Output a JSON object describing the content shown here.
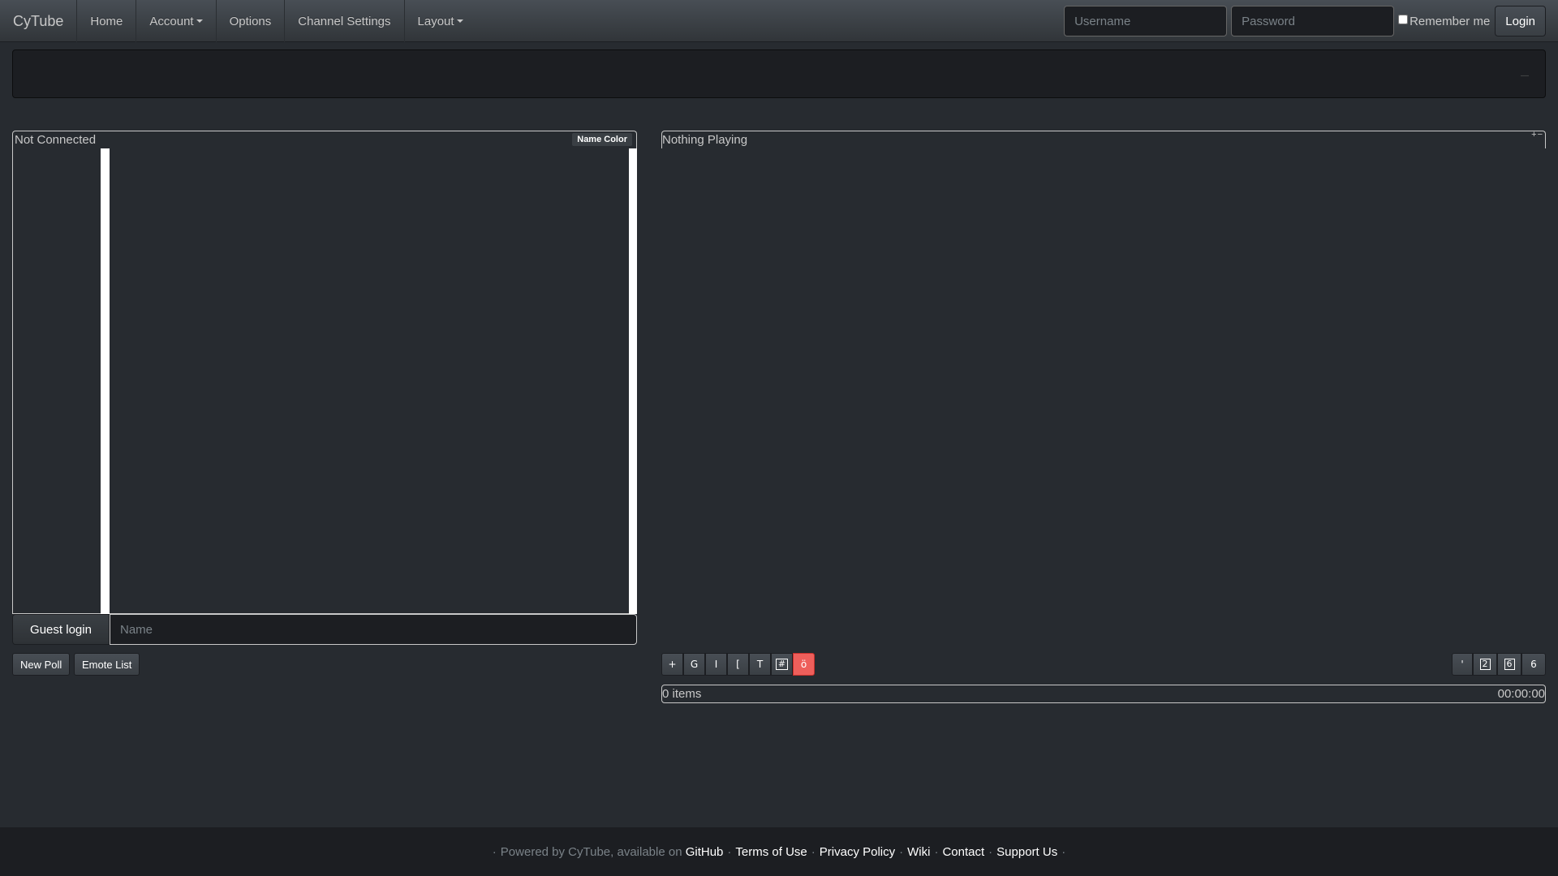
{
  "navbar": {
    "brand": "CyTube",
    "items": [
      {
        "label": "Home"
      },
      {
        "label": "Account"
      },
      {
        "label": "Options"
      },
      {
        "label": "Channel Settings"
      },
      {
        "label": "Layout"
      }
    ],
    "username_placeholder": "Username",
    "password_placeholder": "Password",
    "remember_label": "Remember me",
    "login_label": "Login"
  },
  "chat": {
    "status": "Not Connected",
    "namecolor_label": "Name Color",
    "guest_login_label": "Guest login",
    "guest_name_placeholder": "Name",
    "new_poll_label": "New Poll",
    "emote_list_label": "Emote List"
  },
  "video": {
    "title": "Nothing Playing",
    "header_icons": "+−"
  },
  "playlist": {
    "controls": [
      {
        "icon": "plus-icon",
        "glyph": "+"
      },
      {
        "icon": "google-icon",
        "glyph": "G"
      },
      {
        "icon": "text-cursor-icon",
        "glyph": "I"
      },
      {
        "icon": "bracket-icon",
        "glyph": "["
      },
      {
        "icon": "text-icon",
        "glyph": "T"
      },
      {
        "icon": "hash-icon",
        "glyph": "#"
      },
      {
        "icon": "clear-icon",
        "glyph": "ö"
      }
    ],
    "right_controls": [
      {
        "icon": "quote-icon",
        "glyph": "'"
      },
      {
        "icon": "boxed-2-icon",
        "glyph": "2"
      },
      {
        "icon": "boxed-6-icon",
        "glyph": "6"
      },
      {
        "icon": "six-icon",
        "glyph": "6"
      }
    ],
    "count": "0 items",
    "duration": "00:00:00"
  },
  "footer": {
    "powered_by": "Powered by CyTube, available on",
    "links": [
      "GitHub",
      "Terms of Use",
      "Privacy Policy",
      "Wiki",
      "Contact",
      "Support Us"
    ]
  },
  "colors": {
    "background": "#272b30",
    "navbar": "#3a3f44",
    "danger": "#ee5f5b"
  }
}
